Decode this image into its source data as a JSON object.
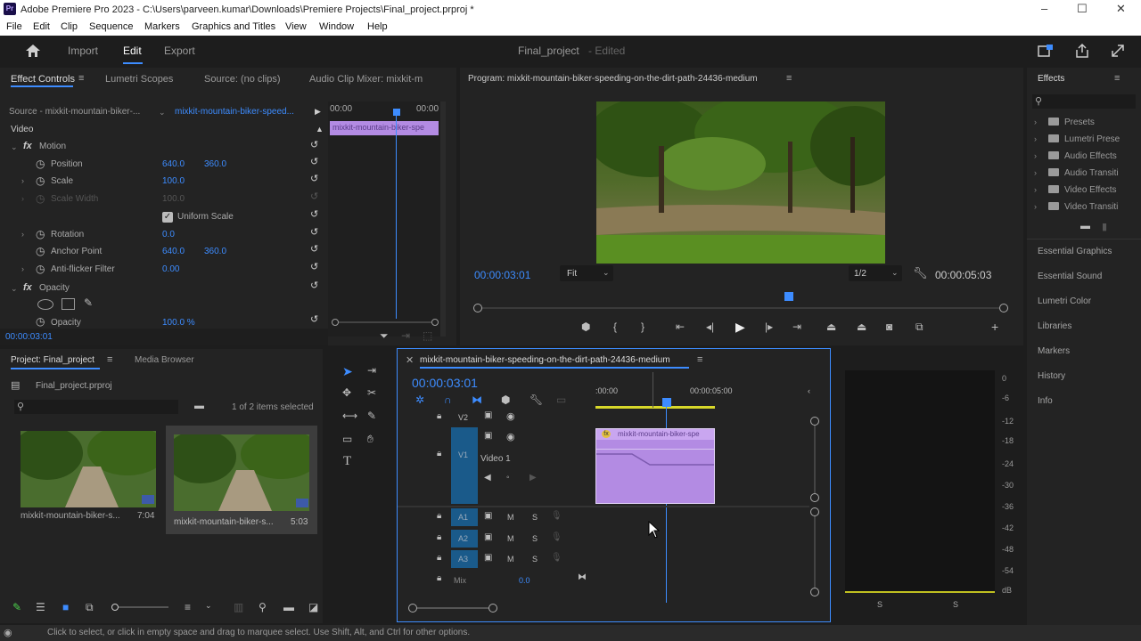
{
  "window": {
    "title": "Adobe Premiere Pro 2023 - C:\\Users\\parveen.kumar\\Downloads\\Premiere Projects\\Final_project.prproj *",
    "app_icon": "Pr",
    "minimize": "–",
    "maximize": "☐",
    "close": "✕"
  },
  "menu": [
    "File",
    "Edit",
    "Clip",
    "Sequence",
    "Markers",
    "Graphics and Titles",
    "View",
    "Window",
    "Help"
  ],
  "header": {
    "tabs": [
      "Import",
      "Edit",
      "Export"
    ],
    "project_name": "Final_project",
    "edited": "- Edited"
  },
  "effect_controls": {
    "tabs": [
      "Effect Controls",
      "Lumetri Scopes",
      "Source: (no clips)",
      "Audio Clip Mixer: mixkit-m"
    ],
    "source": "Source - mixkit-mountain-biker-...",
    "sequence_clip": "mixkit-mountain-biker-speed...",
    "mini_time_left": "00:00",
    "mini_time_right": "00:00",
    "mini_clip": "mixkit-mountain-biker-spe",
    "video_label": "Video",
    "fx": "fx",
    "motion": "Motion",
    "position_label": "Position",
    "position_x": "640.0",
    "position_y": "360.0",
    "scale_label": "Scale",
    "scale_val": "100.0",
    "scale_width_label": "Scale Width",
    "scale_width_val": "100.0",
    "uniform_scale": "Uniform Scale",
    "rotation_label": "Rotation",
    "rotation_val": "0.0",
    "anchor_label": "Anchor Point",
    "anchor_x": "640.0",
    "anchor_y": "360.0",
    "antiflicker_label": "Anti-flicker Filter",
    "antiflicker_val": "0.00",
    "opacity": "Opacity",
    "opacity_label": "Opacity",
    "opacity_val": "100.0 %",
    "timecode": "00:00:03:01"
  },
  "program": {
    "title": "Program: mixkit-mountain-biker-speeding-on-the-dirt-path-24436-medium",
    "timecode": "00:00:03:01",
    "fit": "Fit",
    "resolution": "1/2",
    "duration": "00:00:05:03"
  },
  "project": {
    "tabs": [
      "Project: Final_project",
      "Media Browser"
    ],
    "file": "Final_project.prproj",
    "selection": "1 of 2 items selected",
    "items": [
      {
        "name": "mixkit-mountain-biker-s...",
        "duration": "7:04"
      },
      {
        "name": "mixkit-mountain-biker-s...",
        "duration": "5:03"
      }
    ]
  },
  "timeline": {
    "title": "mixkit-mountain-biker-speeding-on-the-dirt-path-24436-medium",
    "timecode": "00:00:03:01",
    "ruler_start": ":00:00",
    "ruler_mid": "00:00:05:00",
    "tracks": {
      "v2": "V2",
      "v1": "V1",
      "video1": "Video 1",
      "a1": "A1",
      "a2": "A2",
      "a3": "A3",
      "mix": "Mix",
      "mix_val": "0.0"
    },
    "clip_name": "mixkit-mountain-biker-spe",
    "m": "M",
    "s": "S"
  },
  "meters": {
    "labels": [
      "0",
      "-6",
      "-12",
      "-18",
      "-24",
      "-30",
      "-36",
      "-42",
      "-48",
      "-54",
      "dB"
    ],
    "s": "S"
  },
  "effects_panel": {
    "title": "Effects",
    "items": [
      "Presets",
      "Lumetri Prese",
      "Audio Effects",
      "Audio Transiti",
      "Video Effects",
      "Video Transiti"
    ],
    "sections": [
      "Essential Graphics",
      "Essential Sound",
      "Lumetri Color",
      "Libraries",
      "Markers",
      "History",
      "Info"
    ]
  },
  "status": "Click to select, or click in empty space and drag to marquee select. Use Shift, Alt, and Ctrl for other options."
}
